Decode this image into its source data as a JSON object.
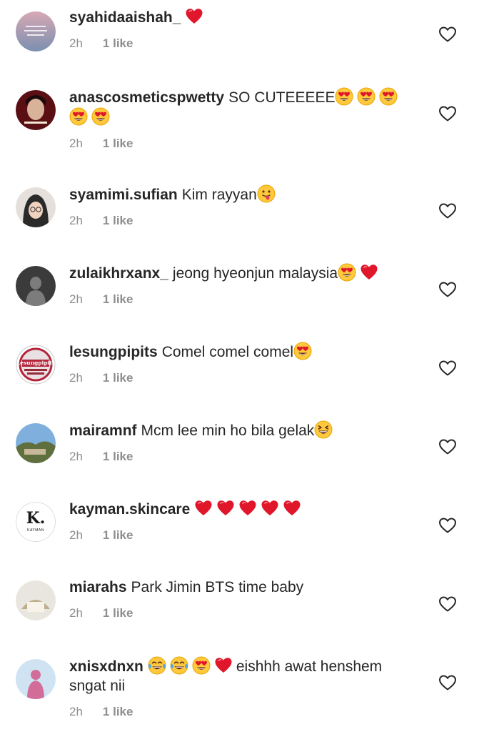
{
  "comments": [
    {
      "username": "syahidaaishah_",
      "text": "",
      "emojis_after": [
        "red-heart"
      ],
      "time": "2h",
      "likes": "1 like",
      "avatar_colors": [
        "#d8a9b4",
        "#7a8fb0"
      ]
    },
    {
      "username": "anascosmeticspwetty",
      "text": "SO CUTEEEEE",
      "emojis_after": [
        "heart-eyes",
        "heart-eyes",
        "heart-eyes",
        "heart-eyes",
        "heart-eyes"
      ],
      "time": "2h",
      "likes": "1 like",
      "avatar_colors": [
        "#5a0f14",
        "#d8b39a"
      ]
    },
    {
      "username": "syamimi.sufian",
      "text": "Kim rayyan",
      "emojis_after": [
        "tongue-face"
      ],
      "time": "2h",
      "likes": "1 like",
      "avatar_colors": [
        "#e5e0db",
        "#2a2a2a"
      ]
    },
    {
      "username": "zulaikhrxanx_",
      "text": "jeong hyeonjun malaysia",
      "emojis_after": [
        "heart-eyes",
        "red-heart"
      ],
      "time": "2h",
      "likes": "1 like",
      "avatar_colors": [
        "#3b3b3b",
        "#7c7c7c"
      ]
    },
    {
      "username": "lesungpipits",
      "text": "Comel comel comel",
      "emojis_after": [
        "heart-eyes"
      ],
      "time": "2h",
      "likes": "1 like",
      "avatar_colors": [
        "#b3263c",
        "#ffffff"
      ],
      "avatar_logo": "Lesungpipits"
    },
    {
      "username": "mairamnf",
      "text": "Mcm lee min ho bila gelak",
      "emojis_after": [
        "laughing-face"
      ],
      "time": "2h",
      "likes": "1 like",
      "avatar_colors": [
        "#7fb0dd",
        "#5f6f3e"
      ]
    },
    {
      "username": "kayman.skincare",
      "text": "",
      "emojis_after": [
        "red-heart",
        "red-heart",
        "red-heart",
        "red-heart",
        "red-heart"
      ],
      "time": "2h",
      "likes": "1 like",
      "avatar_colors": [
        "#ffffff",
        "#1a1a1a"
      ],
      "avatar_logo": "K.",
      "avatar_sub": "KAYMAN"
    },
    {
      "username": "miarahs",
      "text": "Park Jimin BTS time baby",
      "emojis_after": [],
      "time": "2h",
      "likes": "1 like",
      "avatar_colors": [
        "#e9e6df",
        "#bfae8c"
      ]
    },
    {
      "username": "xnisxdnxn",
      "text": "eishhh awat henshem sngat nii",
      "emojis_before": [
        "tears-of-joy",
        "tears-of-joy",
        "heart-eyes",
        "red-heart"
      ],
      "emojis_after": [],
      "time": "2h",
      "likes": "1 like",
      "avatar_colors": [
        "#cfe3f2",
        "#d26d9a"
      ]
    }
  ],
  "colors": {
    "text": "#262626",
    "meta": "#8e8e8e",
    "heart_outline": "#262626",
    "emoji_red": "#e0162b",
    "emoji_yellow": "#ffc83d"
  },
  "icons": {
    "like_button": "heart-outline-icon"
  }
}
